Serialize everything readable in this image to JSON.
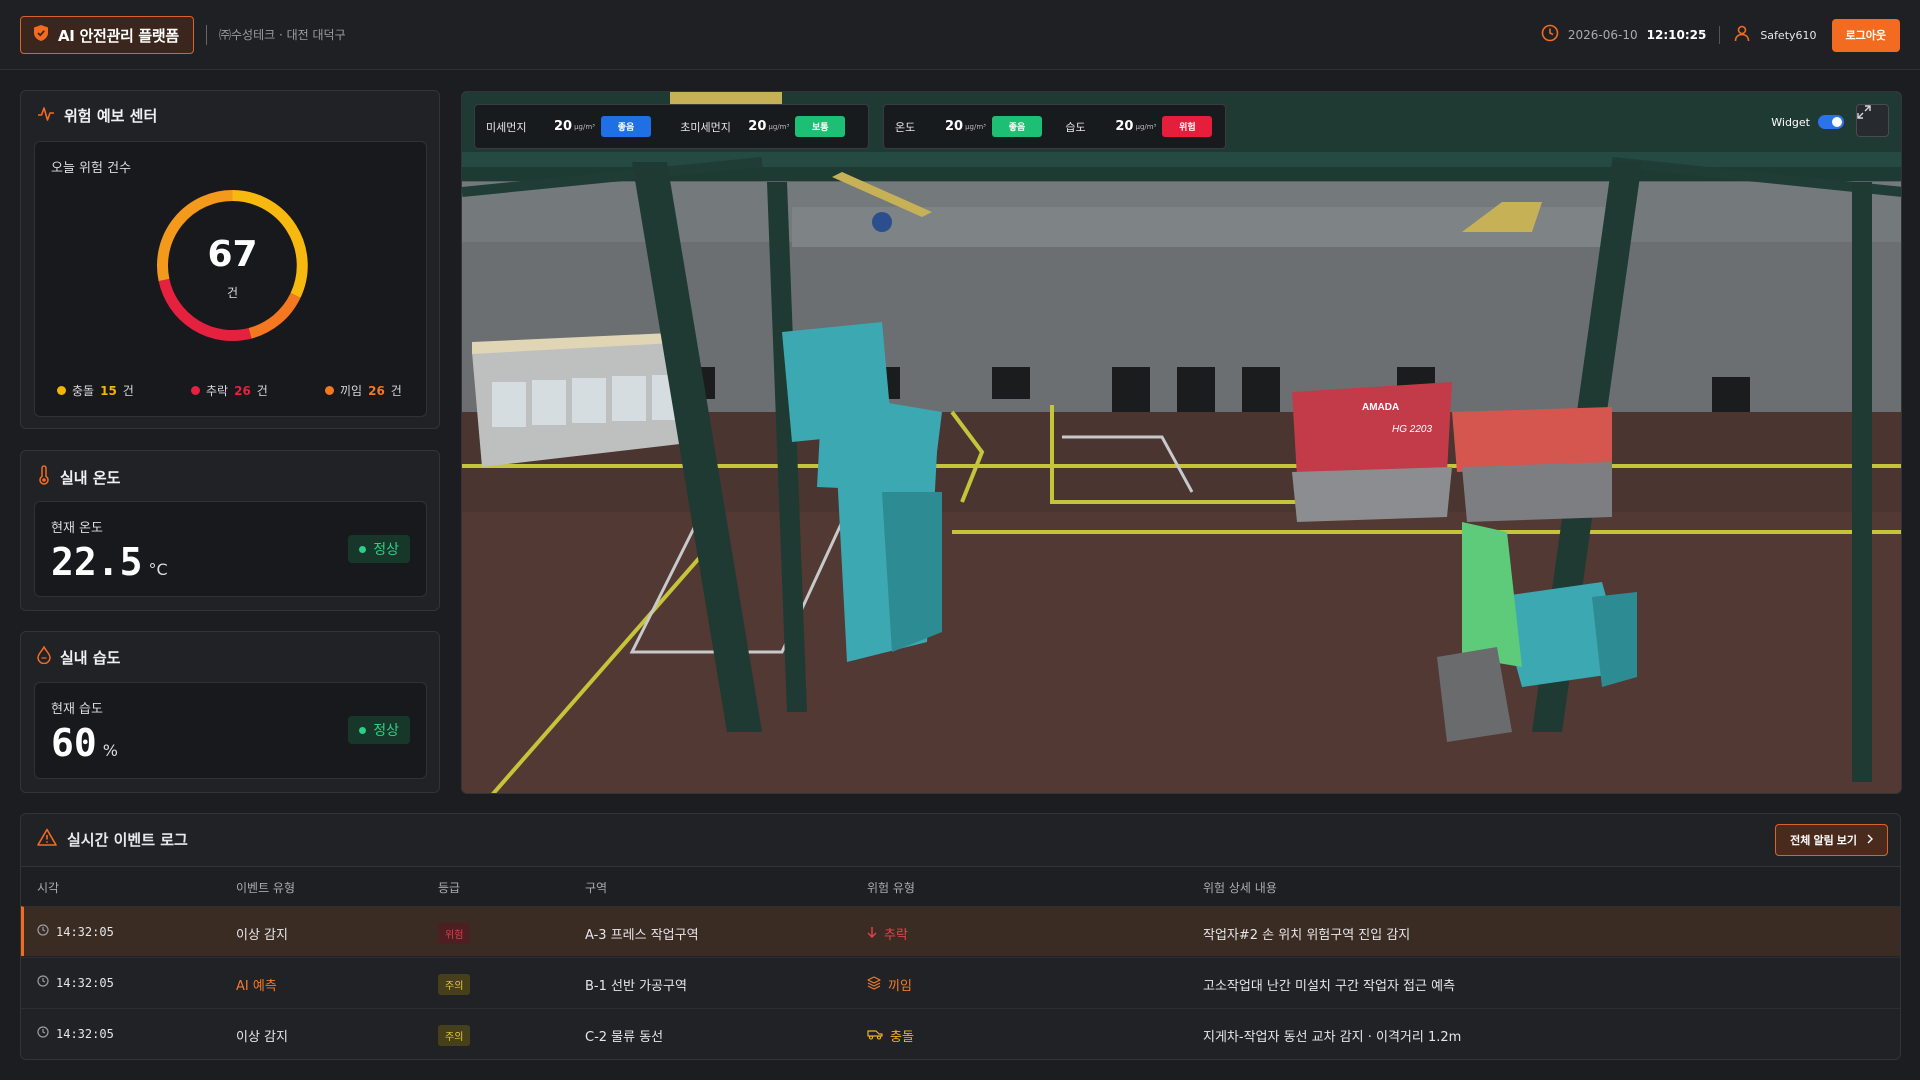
{
  "header": {
    "brand_title": "AI 안전관리 플랫폼",
    "company": "㈜수성테크 · 대전 대덕구",
    "date": "2026-06-10",
    "time": "12:10:25",
    "user": "Safety610",
    "logout_label": "로그아웃"
  },
  "forecast": {
    "title": "위험 예보 센터",
    "today_label": "오늘 위험 건수",
    "total": "67",
    "unit": "건",
    "legend": [
      {
        "label": "충돌",
        "value": "15",
        "unit": "건",
        "color": "#f5b400"
      },
      {
        "label": "추락",
        "value": "26",
        "unit": "건",
        "color": "#e5213f"
      },
      {
        "label": "끼임",
        "value": "26",
        "unit": "건",
        "color": "#f5771f"
      }
    ]
  },
  "temperature": {
    "title": "실내 온도",
    "current_label": "현재 온도",
    "value": "22.5",
    "unit": "°C",
    "status": "정상"
  },
  "humidity": {
    "title": "실내 습도",
    "current_label": "현재 습도",
    "value": "60",
    "unit": "%",
    "status": "정상"
  },
  "sensors": [
    {
      "label": "미세먼지",
      "value": "20",
      "unit": "μg/m³",
      "status": "좋음",
      "color": "#1f6fe5"
    },
    {
      "label": "초미세먼지",
      "value": "20",
      "unit": "μg/m³",
      "status": "보통",
      "color": "#1cbf73"
    },
    {
      "label": "온도",
      "value": "20",
      "unit": "μg/m³",
      "status": "좋음",
      "color": "#1cbf73"
    },
    {
      "label": "습도",
      "value": "20",
      "unit": "μg/m³",
      "status": "위험",
      "color": "#e61e3c"
    }
  ],
  "scene": {
    "widget_label": "Widget",
    "widget_on": true,
    "machine_brand": "AMADA",
    "machine_model": "HG 2203"
  },
  "event_log": {
    "title": "실시간 이벤트 로그",
    "view_all_label": "전체 알림 보기",
    "columns": [
      "시각",
      "이벤트 유형",
      "등급",
      "구역",
      "위험 유형",
      "위험 상세 내용"
    ],
    "rows": [
      {
        "time": "14:32:05",
        "event_type": "이상 감지",
        "grade": "위험",
        "zone": "A-3 프레스 작업구역",
        "risk_type": "추락",
        "detail": "작업자#2 손 위치 위험구역 진입 감지"
      },
      {
        "time": "14:32:05",
        "event_type": "AI 예측",
        "grade": "주의",
        "zone": "B-1 선반 가공구역",
        "risk_type": "끼임",
        "detail": "고소작업대 난간 미설치 구간 작업자 접근 예측"
      },
      {
        "time": "14:32:05",
        "event_type": "이상 감지",
        "grade": "주의",
        "zone": "C-2 물류 동선",
        "risk_type": "충돌",
        "detail": "지게차-작업자 동선 교차 감지 · 이격거리 1.2m"
      }
    ]
  }
}
